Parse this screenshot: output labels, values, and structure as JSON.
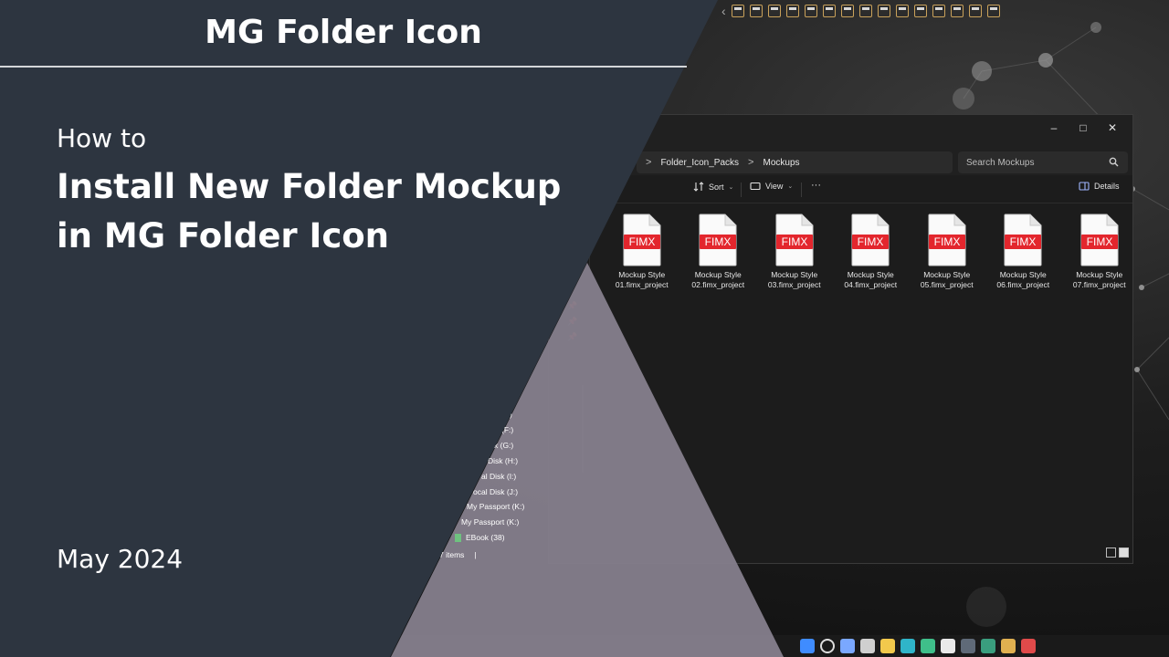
{
  "banner": {
    "brand_title": "MG Folder Icon",
    "how_to": "How to",
    "title_line1": "Install New Folder Mockup",
    "title_line2": "in MG Folder Icon",
    "date": "May 2024"
  },
  "explorer": {
    "breadcrumbs": [
      "Folder_Icon_Packs",
      "Mockups"
    ],
    "breadcrumb_separator": ">",
    "search_placeholder": "Search Mockups",
    "window_controls": {
      "minimize": "–",
      "maximize": "□",
      "close": "✕"
    },
    "toolbar": {
      "sort_label": "Sort",
      "view_label": "View",
      "more_label": "···",
      "details_label": "Details"
    },
    "files": [
      {
        "badge": "FIMX",
        "name_line1": "Mockup Style",
        "name_line2": "01.fimx_project"
      },
      {
        "badge": "FIMX",
        "name_line1": "Mockup Style",
        "name_line2": "02.fimx_project"
      },
      {
        "badge": "FIMX",
        "name_line1": "Mockup Style",
        "name_line2": "03.fimx_project"
      },
      {
        "badge": "FIMX",
        "name_line1": "Mockup Style",
        "name_line2": "04.fimx_project"
      },
      {
        "badge": "FIMX",
        "name_line1": "Mockup Style",
        "name_line2": "05.fimx_project"
      },
      {
        "badge": "FIMX",
        "name_line1": "Mockup Style",
        "name_line2": "06.fimx_project"
      },
      {
        "badge": "FIMX",
        "name_line1": "Mockup Style",
        "name_line2": "07.fimx_project"
      }
    ],
    "nav_items": [
      ")",
      "(F:)",
      "k (G:)",
      "Disk (H:)",
      "al Disk (I:)",
      "ocal Disk (J:)",
      "My Passport (K:)",
      "My Passport (K:)",
      "EBook (38)"
    ],
    "status_text": "7 items",
    "status_sep": "|"
  },
  "colors": {
    "panel_dark": "#2d3540",
    "triangle_light": "#7c7683",
    "badge_red": "#e3262d",
    "accent_green": "#6ec27f"
  },
  "icons": [
    "back-chevron-icon",
    "folder-icon",
    "pin-icon",
    "search-icon",
    "sort-icon",
    "view-icon",
    "details-pane-icon",
    "windows-start-icon",
    "file-explorer-icon",
    "edge-icon",
    "chrome-icon"
  ]
}
